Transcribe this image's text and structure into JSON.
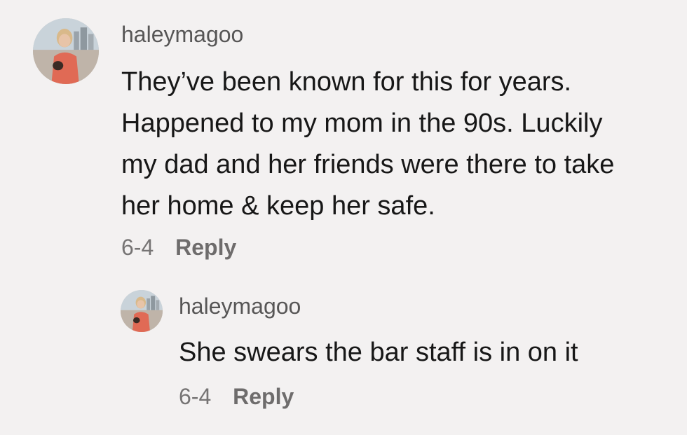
{
  "comments": [
    {
      "username": "haleymagoo",
      "text": "They’ve been known for this for years.\nHappened to my mom in the 90s. Luckily\nmy dad and her friends were there to take\nher home & keep her safe.",
      "date": "6-4",
      "reply_label": "Reply",
      "avatar_icon": "profile-photo"
    },
    {
      "username": "haleymagoo",
      "text": "She swears the bar staff is in on it",
      "date": "6-4",
      "reply_label": "Reply",
      "avatar_icon": "profile-photo"
    }
  ],
  "colors": {
    "background": "#f3f1f1",
    "username": "#575656",
    "body_text": "#171717",
    "meta_text": "#767474"
  }
}
